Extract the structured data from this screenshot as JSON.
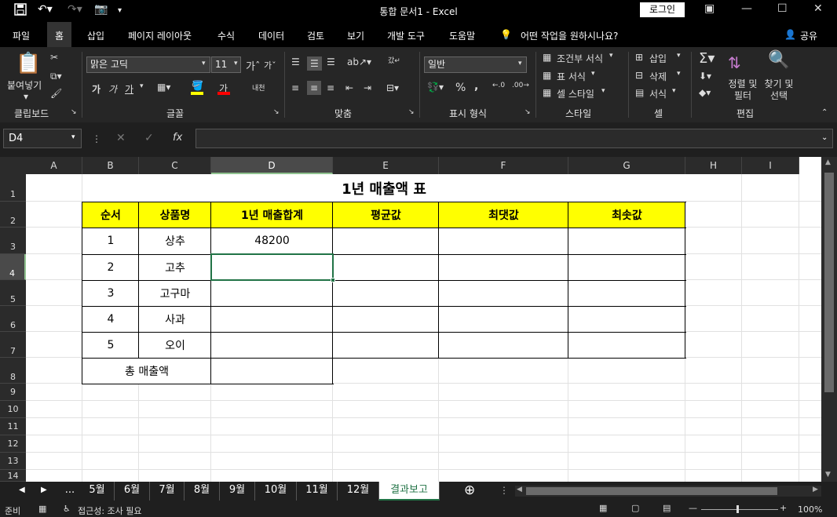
{
  "window": {
    "title": "통합 문서1 - Excel",
    "login": "로그인"
  },
  "menu": {
    "file": "파일",
    "home": "홈",
    "insert": "삽입",
    "layout": "페이지 레이아웃",
    "formulas": "수식",
    "data": "데이터",
    "review": "검토",
    "view": "보기",
    "developer": "개발 도구",
    "help": "도움말",
    "tell": "어떤 작업을 원하시나요?",
    "share": "공유"
  },
  "ribbon": {
    "paste": "붙여넣기",
    "clipboard": "클립보드",
    "font_name": "맑은 고딕",
    "font_size": "11",
    "font": "글꼴",
    "bold": "가",
    "italic": "가",
    "underline": "가",
    "font_color": "가",
    "alignment": "맞춤",
    "wrap": "내천",
    "number_format": "일반",
    "number": "표시 형식",
    "cond_format": "조건부 서식",
    "table_format": "표 서식",
    "cell_style": "셀 스타일",
    "styles": "스타일",
    "insert": "삽입",
    "delete": "삭제",
    "format": "서식",
    "cells": "셀",
    "sort_filter": "정렬 및 필터",
    "find_select": "찾기 및 선택",
    "editing": "편집"
  },
  "formula_bar": {
    "name_box": "D4",
    "value": ""
  },
  "sheet": {
    "columns": [
      "A",
      "B",
      "C",
      "D",
      "E",
      "F",
      "G",
      "H",
      "I"
    ],
    "rows": [
      "1",
      "2",
      "3",
      "4",
      "5",
      "6",
      "7",
      "8",
      "9",
      "10",
      "11",
      "12",
      "13",
      "14"
    ],
    "title": "1년 매출액 표",
    "headers": [
      "순서",
      "상품명",
      "1년 매출합계",
      "평균값",
      "최댓값",
      "최솟값"
    ],
    "body": [
      [
        "1",
        "상추",
        "48200"
      ],
      [
        "2",
        "고추",
        ""
      ],
      [
        "3",
        "고구마",
        ""
      ],
      [
        "4",
        "사과",
        ""
      ],
      [
        "5",
        "오이",
        ""
      ]
    ],
    "total_label": "총 매출액",
    "header_fill": "#ffff00"
  },
  "tabs": [
    "...",
    "5월",
    "6월",
    "7월",
    "8월",
    "9월",
    "10월",
    "11월",
    "12월",
    "결과보고"
  ],
  "status": {
    "ready": "준비",
    "accessibility": "접근성: 조사 필요",
    "zoom": "100%"
  },
  "colors": {
    "excel_green": "#217346",
    "dark_bg": "#1f1f1f"
  }
}
